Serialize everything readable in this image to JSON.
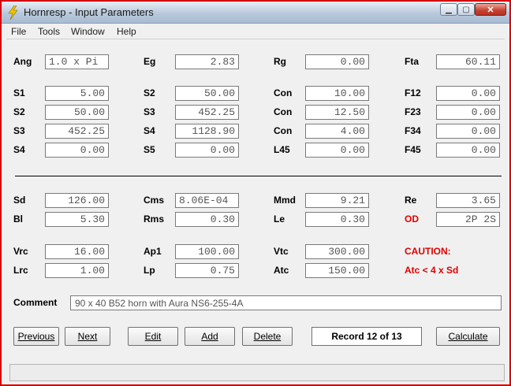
{
  "window": {
    "title": "Hornresp - Input Parameters",
    "close_glyph": "✕",
    "min_glyph": "▁",
    "max_glyph": "▢"
  },
  "menu": [
    "File",
    "Tools",
    "Window",
    "Help"
  ],
  "params": {
    "Ang": "1.0 x Pi",
    "Eg": "2.83",
    "Rg": "0.00",
    "Fta": "60.11",
    "S1": "5.00",
    "S2a": "50.00",
    "Con1": "10.00",
    "F12": "0.00",
    "S2b": "50.00",
    "S3a": "452.25",
    "Con2": "12.50",
    "F23": "0.00",
    "S3b": "452.25",
    "S4a": "1128.90",
    "Con3": "4.00",
    "F34": "0.00",
    "S4b": "0.00",
    "S5": "0.00",
    "L45": "0.00",
    "F45": "0.00",
    "Sd": "126.00",
    "Cms": "8.06E-04",
    "Mmd": "9.21",
    "Re": "3.65",
    "Bl": "5.30",
    "Rms": "0.30",
    "Le": "0.30",
    "OD": "2P 2S",
    "Vrc": "16.00",
    "Ap1": "100.00",
    "Vtc": "300.00",
    "Lrc": "1.00",
    "Lp": "0.75",
    "Atc": "150.00"
  },
  "labels": {
    "ang": "Ang",
    "eg": "Eg",
    "rg": "Rg",
    "fta": "Fta",
    "s1": "S1",
    "s2": "S2",
    "s3": "S3",
    "s4": "S4",
    "s5": "S5",
    "con": "Con",
    "l45": "L45",
    "f12": "F12",
    "f23": "F23",
    "f34": "F34",
    "f45": "F45",
    "sd": "Sd",
    "cms": "Cms",
    "mmd": "Mmd",
    "re": "Re",
    "bl": "Bl",
    "rms": "Rms",
    "le": "Le",
    "od": "OD",
    "vrc": "Vrc",
    "ap1": "Ap1",
    "vtc": "Vtc",
    "lrc": "Lrc",
    "lp": "Lp",
    "atc": "Atc",
    "caution": "CAUTION:",
    "caution_msg": "Atc < 4 x Sd",
    "comment": "Comment"
  },
  "comment_value": "90 x 40 B52 horn with Aura NS6-255-4A",
  "buttons": {
    "previous": "Previous",
    "next": "Next",
    "edit": "Edit",
    "add": "Add",
    "delete": "Delete",
    "calculate": "Calculate"
  },
  "record": "Record 12 of 13",
  "colors": {
    "warning": "#e00000",
    "window_border": "#d40000"
  }
}
